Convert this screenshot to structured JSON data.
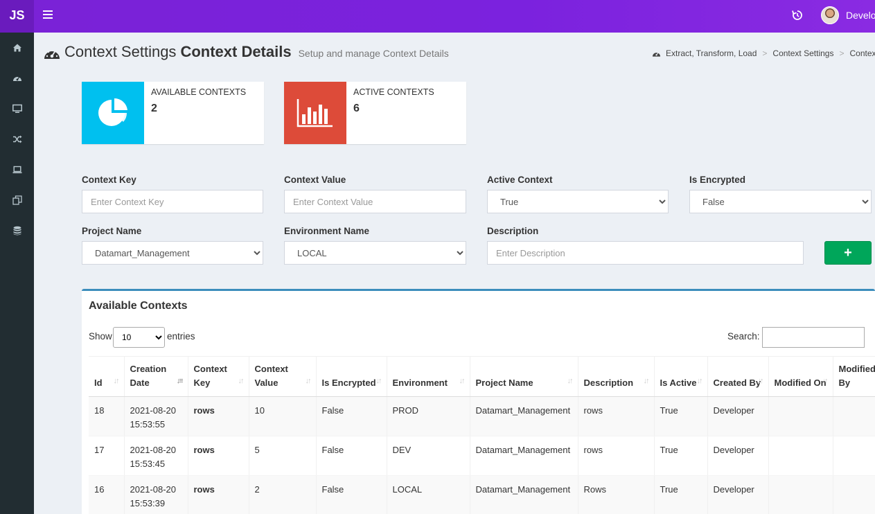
{
  "app": {
    "logo": "JS",
    "user_name": "Developer"
  },
  "sidebar": {
    "items": [
      {
        "name": "sidebar-item-home",
        "icon": "home-icon"
      },
      {
        "name": "sidebar-item-dashboard",
        "icon": "dashboard-icon"
      },
      {
        "name": "sidebar-item-monitor",
        "icon": "monitor-icon"
      },
      {
        "name": "sidebar-item-shuffle",
        "icon": "shuffle-icon"
      },
      {
        "name": "sidebar-item-laptop",
        "icon": "laptop-icon"
      },
      {
        "name": "sidebar-item-copy",
        "icon": "copy-icon"
      },
      {
        "name": "sidebar-item-database",
        "icon": "database-icon"
      }
    ]
  },
  "page": {
    "title": "Context Settings",
    "title_bold": "Context Details",
    "subtitle": "Setup and manage Context Details"
  },
  "breadcrumb": [
    "Extract, Transform, Load",
    "Context Settings",
    "Context Details"
  ],
  "info_boxes": [
    {
      "label": "AVAILABLE CONTEXTS",
      "value": "2",
      "color": "#00c0ef",
      "icon": "pie-chart-icon"
    },
    {
      "label": "ACTIVE CONTEXTS",
      "value": "6",
      "color": "#dd4b39",
      "icon": "bar-chart-icon"
    }
  ],
  "form": {
    "context_key": {
      "label": "Context Key",
      "placeholder": "Enter Context Key",
      "value": ""
    },
    "context_value": {
      "label": "Context Value",
      "placeholder": "Enter Context Value",
      "value": ""
    },
    "active_context": {
      "label": "Active Context",
      "value": "True"
    },
    "is_encrypted": {
      "label": "Is Encrypted",
      "value": "False"
    },
    "project_name": {
      "label": "Project Name",
      "value": "Datamart_Management"
    },
    "environment_name": {
      "label": "Environment Name",
      "value": "LOCAL"
    },
    "description": {
      "label": "Description",
      "placeholder": "Enter Description",
      "value": ""
    },
    "add_button": "+"
  },
  "table_box": {
    "title": "Available Contexts",
    "show_label": "Show",
    "entries_value": "10",
    "entries_label": "entries",
    "search_label": "Search:",
    "columns": [
      {
        "label": "Id"
      },
      {
        "label": "Creation Date"
      },
      {
        "label": "Context Key"
      },
      {
        "label": "Context Value"
      },
      {
        "label": "Is Encrypted"
      },
      {
        "label": "Environment"
      },
      {
        "label": "Project Name"
      },
      {
        "label": "Description"
      },
      {
        "label": "Is Active"
      },
      {
        "label": "Created By"
      },
      {
        "label": "Modified On"
      },
      {
        "label": "Modified By"
      }
    ],
    "rows": [
      [
        "18",
        "2021-08-20 15:53:55",
        "rows",
        "10",
        "False",
        "PROD",
        "Datamart_Management",
        "rows",
        "True",
        "Developer",
        "",
        ""
      ],
      [
        "17",
        "2021-08-20 15:53:45",
        "rows",
        "5",
        "False",
        "DEV",
        "Datamart_Management",
        "rows",
        "True",
        "Developer",
        "",
        ""
      ],
      [
        "16",
        "2021-08-20 15:53:39",
        "rows",
        "2",
        "False",
        "LOCAL",
        "Datamart_Management",
        "Rows",
        "True",
        "Developer",
        "",
        ""
      ]
    ]
  }
}
